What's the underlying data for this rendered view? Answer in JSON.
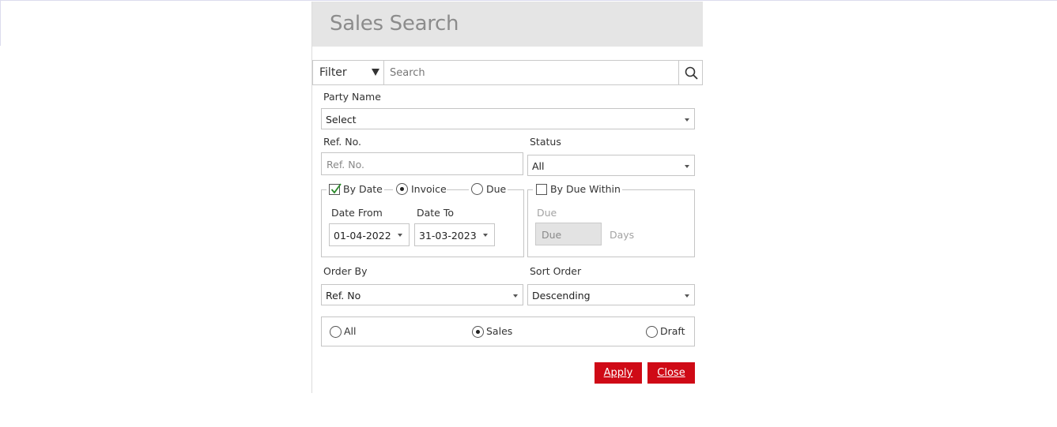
{
  "window": {
    "title": "Sales Search"
  },
  "search_bar": {
    "filter_label": "Filter",
    "search_placeholder": "Search"
  },
  "party": {
    "label": "Party Name",
    "value": "Select"
  },
  "ref": {
    "label": "Ref. No.",
    "placeholder": "Ref. No."
  },
  "status": {
    "label": "Status",
    "value": "All"
  },
  "date_group": {
    "by_date_label": "By Date",
    "by_date_checked": true,
    "invoice_label": "Invoice",
    "due_label": "Due",
    "selected_mode": "Invoice",
    "date_from_label": "Date From",
    "date_from_value": "01-04-2022",
    "date_to_label": "Date To",
    "date_to_value": "31-03-2023"
  },
  "due_group": {
    "by_due_within_label": "By Due Within",
    "by_due_within_checked": false,
    "due_label": "Due",
    "due_placeholder": "Due",
    "days_label": "Days"
  },
  "order_by": {
    "label": "Order By",
    "value": "Ref. No"
  },
  "sort_order": {
    "label": "Sort Order",
    "value": "Descending"
  },
  "type_filter": {
    "options": [
      "All",
      "Sales",
      "Draft"
    ],
    "selected": "Sales"
  },
  "actions": {
    "apply_label": "Apply",
    "close_label": "Close"
  },
  "colors": {
    "accent": "#cf0a16",
    "header_bg": "#e5e5e5",
    "checkmark": "#2a8a2a"
  }
}
